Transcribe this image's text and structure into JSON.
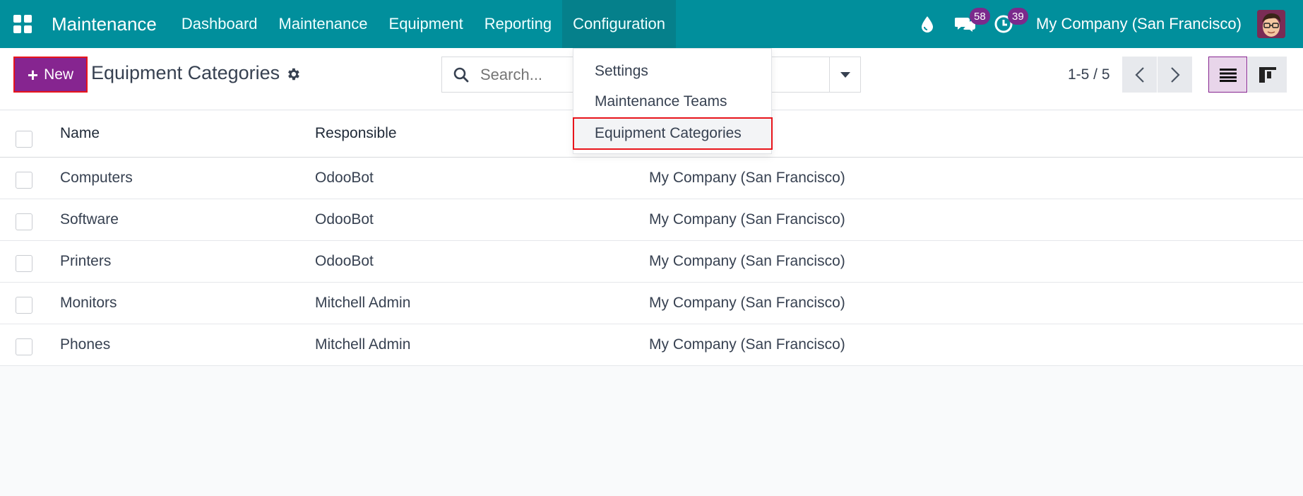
{
  "navbar": {
    "brand": "Maintenance",
    "menu": [
      "Dashboard",
      "Maintenance",
      "Equipment",
      "Reporting",
      "Configuration"
    ],
    "active_menu": "Configuration",
    "messages_badge": "58",
    "activities_badge": "39",
    "company": "My Company (San Francisco)"
  },
  "control": {
    "new_label": "New",
    "title": "Equipment Categories",
    "search_placeholder": "Search...",
    "pager": "1-5 / 5"
  },
  "dropdown": {
    "items": [
      "Settings",
      "Maintenance Teams",
      "Equipment Categories"
    ],
    "highlighted": "Equipment Categories"
  },
  "list": {
    "columns": [
      "Name",
      "Responsible"
    ],
    "rows": [
      {
        "name": "Computers",
        "responsible": "OdooBot",
        "company": "My Company (San Francisco)"
      },
      {
        "name": "Software",
        "responsible": "OdooBot",
        "company": "My Company (San Francisco)"
      },
      {
        "name": "Printers",
        "responsible": "OdooBot",
        "company": "My Company (San Francisco)"
      },
      {
        "name": "Monitors",
        "responsible": "Mitchell Admin",
        "company": "My Company (San Francisco)"
      },
      {
        "name": "Phones",
        "responsible": "Mitchell Admin",
        "company": "My Company (San Francisco)"
      }
    ]
  },
  "colors": {
    "navbar": "#018f9c",
    "primary": "#862590",
    "highlight_border": "#e8141b"
  }
}
